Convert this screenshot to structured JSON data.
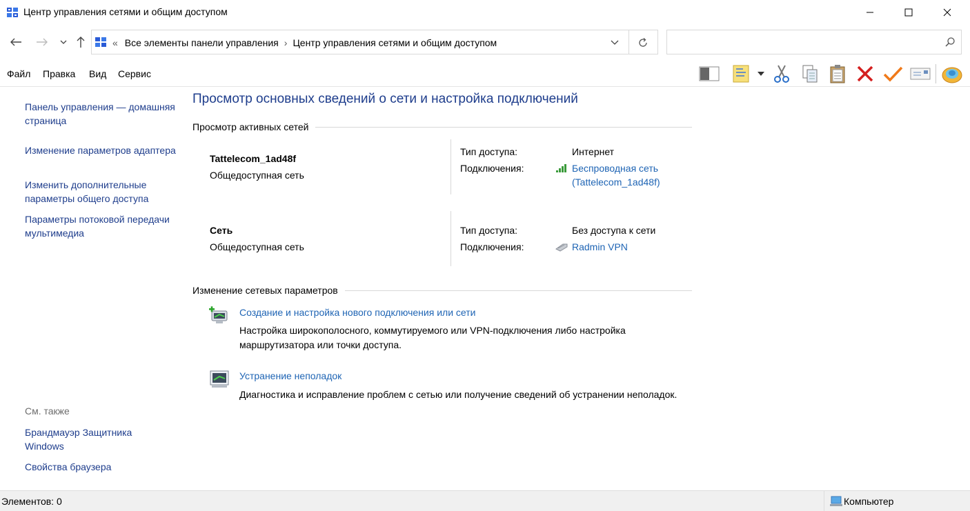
{
  "window": {
    "title": "Центр управления сетями и общим доступом",
    "icon": "control-panel-icon",
    "controls": [
      "minimize-icon",
      "maximize-icon",
      "close-icon"
    ]
  },
  "navigation": {
    "breadcrumb_overflow": "«",
    "breadcrumbs": [
      "Все элементы панели управления",
      "Центр управления сетями и общим доступом"
    ],
    "search_placeholder": ""
  },
  "menu": {
    "items": [
      "Файл",
      "Правка",
      "Вид",
      "Сервис"
    ]
  },
  "toolbar": {
    "buttons": [
      "preview-pane-icon",
      "properties-icon",
      "dropdown-arrow-icon",
      "cut-icon",
      "copy-icon",
      "paste-icon",
      "delete-icon",
      "check-icon",
      "envelope-icon",
      "shell-icon"
    ]
  },
  "left_pane": {
    "links": [
      "Панель управления — домашняя страница",
      "Изменение параметров адаптера",
      "Изменить дополнительные параметры общего доступа",
      "Параметры потоковой передачи мультимедиа"
    ],
    "see_also_label": "См. также",
    "see_also_links": [
      "Брандмауэр Защитника Windows",
      "Свойства браузера"
    ]
  },
  "main": {
    "heading": "Просмотр основных сведений о сети и настройка подключений",
    "active_networks_label": "Просмотр активных сетей",
    "networks": [
      {
        "name": "Tattelecom_1ad48f",
        "category": "Общедоступная сеть",
        "access_label": "Тип доступа:",
        "access_value": "Интернет",
        "connections_label": "Подключения:",
        "connection_line1": "Беспроводная сеть",
        "connection_line2": "(Tattelecom_1ad48f)",
        "connection_icon": "wifi-signal-icon"
      },
      {
        "name": "Сеть",
        "category": "Общедоступная сеть",
        "access_label": "Тип доступа:",
        "access_value": "Без доступа к сети",
        "connections_label": "Подключения:",
        "connection_line1": "Radmin VPN",
        "connection_line2": "",
        "connection_icon": "ethernet-cable-icon"
      }
    ],
    "change_settings_label": "Изменение сетевых параметров",
    "tasks": [
      {
        "title": "Создание и настройка нового подключения или сети",
        "description": "Настройка широкополосного, коммутируемого или VPN-подключения либо настройка маршрутизатора или точки доступа.",
        "icon": "new-connection-icon"
      },
      {
        "title": "Устранение неполадок",
        "description": "Диагностика и исправление проблем с сетью или получение сведений об устранении неполадок.",
        "icon": "troubleshoot-icon"
      }
    ]
  },
  "statusbar": {
    "items_count": "Элементов: 0",
    "zone": "Компьютер",
    "zone_icon": "computer-icon"
  },
  "colors": {
    "heading_blue": "#1e3d8c",
    "link_blue": "#1e64b4",
    "divider": "#d8d8d8"
  }
}
